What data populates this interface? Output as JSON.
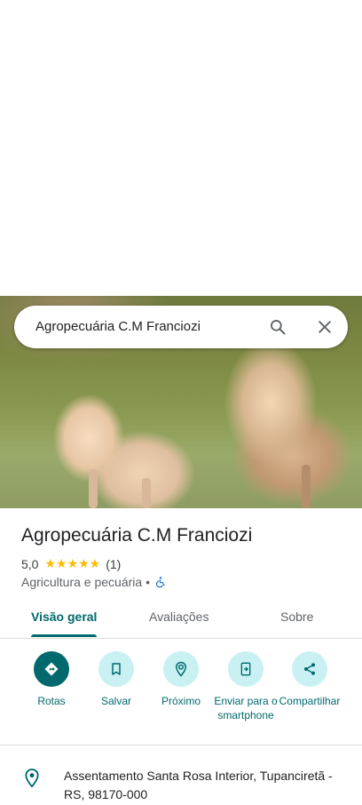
{
  "search": {
    "query": "Agropecuária C.M Franciozi"
  },
  "place": {
    "name": "Agropecuária C.M Franciozi",
    "rating": "5,0",
    "reviews": "(1)",
    "category": "Agricultura e pecuária •"
  },
  "tabs": [
    {
      "label": "Visão geral",
      "active": true
    },
    {
      "label": "Avaliações",
      "active": false
    },
    {
      "label": "Sobre",
      "active": false
    }
  ],
  "actions": [
    {
      "label": "Rotas",
      "icon": "directions-icon"
    },
    {
      "label": "Salvar",
      "icon": "bookmark-icon"
    },
    {
      "label": "Próximo",
      "icon": "nearby-icon"
    },
    {
      "label": "Enviar para o smartphone",
      "icon": "send-to-phone-icon"
    },
    {
      "label": "Compartilhar",
      "icon": "share-icon"
    }
  ],
  "address": "Assentamento Santa Rosa Interior, Tupanciretã - RS, 98170-000",
  "colors": {
    "accent": "#00696d",
    "star": "#fbbc04",
    "action_bg": "#c9f0f2"
  }
}
